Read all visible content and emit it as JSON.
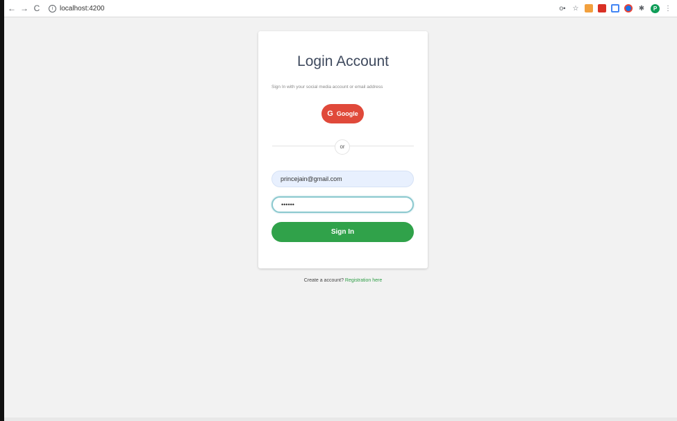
{
  "browser": {
    "back_icon": "←",
    "forward_icon": "→",
    "reload_icon": "C",
    "info_icon": "i",
    "url": "localhost:4200",
    "key_icon": "o▪",
    "star_icon": "☆",
    "puzzle_icon": "✱",
    "profile_initial": "P",
    "menu_icon": "⋮"
  },
  "login": {
    "title": "Login Account",
    "subtitle": "Sign In with your social media account or email address",
    "google_icon": "G",
    "google_label": "Google",
    "or_label": "or",
    "email_value": "princejain@gmail.com",
    "password_value": "••••••",
    "signin_label": "Sign In"
  },
  "footer": {
    "prompt": "Create a account?",
    "link": "Registration here"
  },
  "colors": {
    "google": "#e0493a",
    "signin": "#30a24a",
    "link": "#2e9e46",
    "title": "#3f4a5e"
  }
}
